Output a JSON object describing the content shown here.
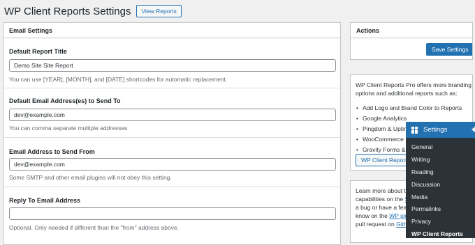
{
  "header": {
    "title": "WP Client Reports Settings",
    "view_reports_label": "View Reports"
  },
  "email_settings": {
    "title": "Email Settings",
    "report_title": {
      "label": "Default Report Title",
      "value": "Demo Site Site Report",
      "help": "You can use [YEAR], [MONTH], and [DATE] shortcodes for automatic replacement."
    },
    "send_to": {
      "label": "Default Email Address(es) to Send To",
      "value": "dev@example.com",
      "help": "You can comma separate multiple addresses"
    },
    "send_from": {
      "label": "Email Address to Send From",
      "value": "dev@example.com",
      "help": "Some SMTP and other email plugins will not obey this setting."
    },
    "reply_to": {
      "label": "Reply To Email Address",
      "value": "",
      "help": "Optional. Only needed if different than the \"from\" address above."
    }
  },
  "actions": {
    "title": "Actions",
    "save_label": "Save Settings"
  },
  "promo": {
    "text": "WP Client Reports Pro offers more branding options and additional reports such as:",
    "items": [
      "Add Logo and Brand Color to Reports",
      "Google Analytics",
      "Pingdom & Uptime Robot",
      "WooCommerce",
      "Gravity Forms &"
    ],
    "button_label": "WP Client Reports"
  },
  "learn": {
    "line1": "Learn more about th",
    "line2_a": "capabilities on the ",
    "line2_link": "S",
    "line3": "a bug or have a feat",
    "line4_a": "know on the ",
    "line4_link": "WP plu",
    "line5_a": "pull request on ",
    "line5_link": "GitH"
  },
  "settings_menu": {
    "title": "Settings",
    "items": [
      "General",
      "Writing",
      "Reading",
      "Discussion",
      "Media",
      "Permalinks",
      "Privacy",
      "WP Client Reports"
    ],
    "current_index": 7
  },
  "colors": {
    "accent": "#2271b1",
    "admin_menu_bg": "#2c3338",
    "page_bg": "#f0f0f1"
  }
}
